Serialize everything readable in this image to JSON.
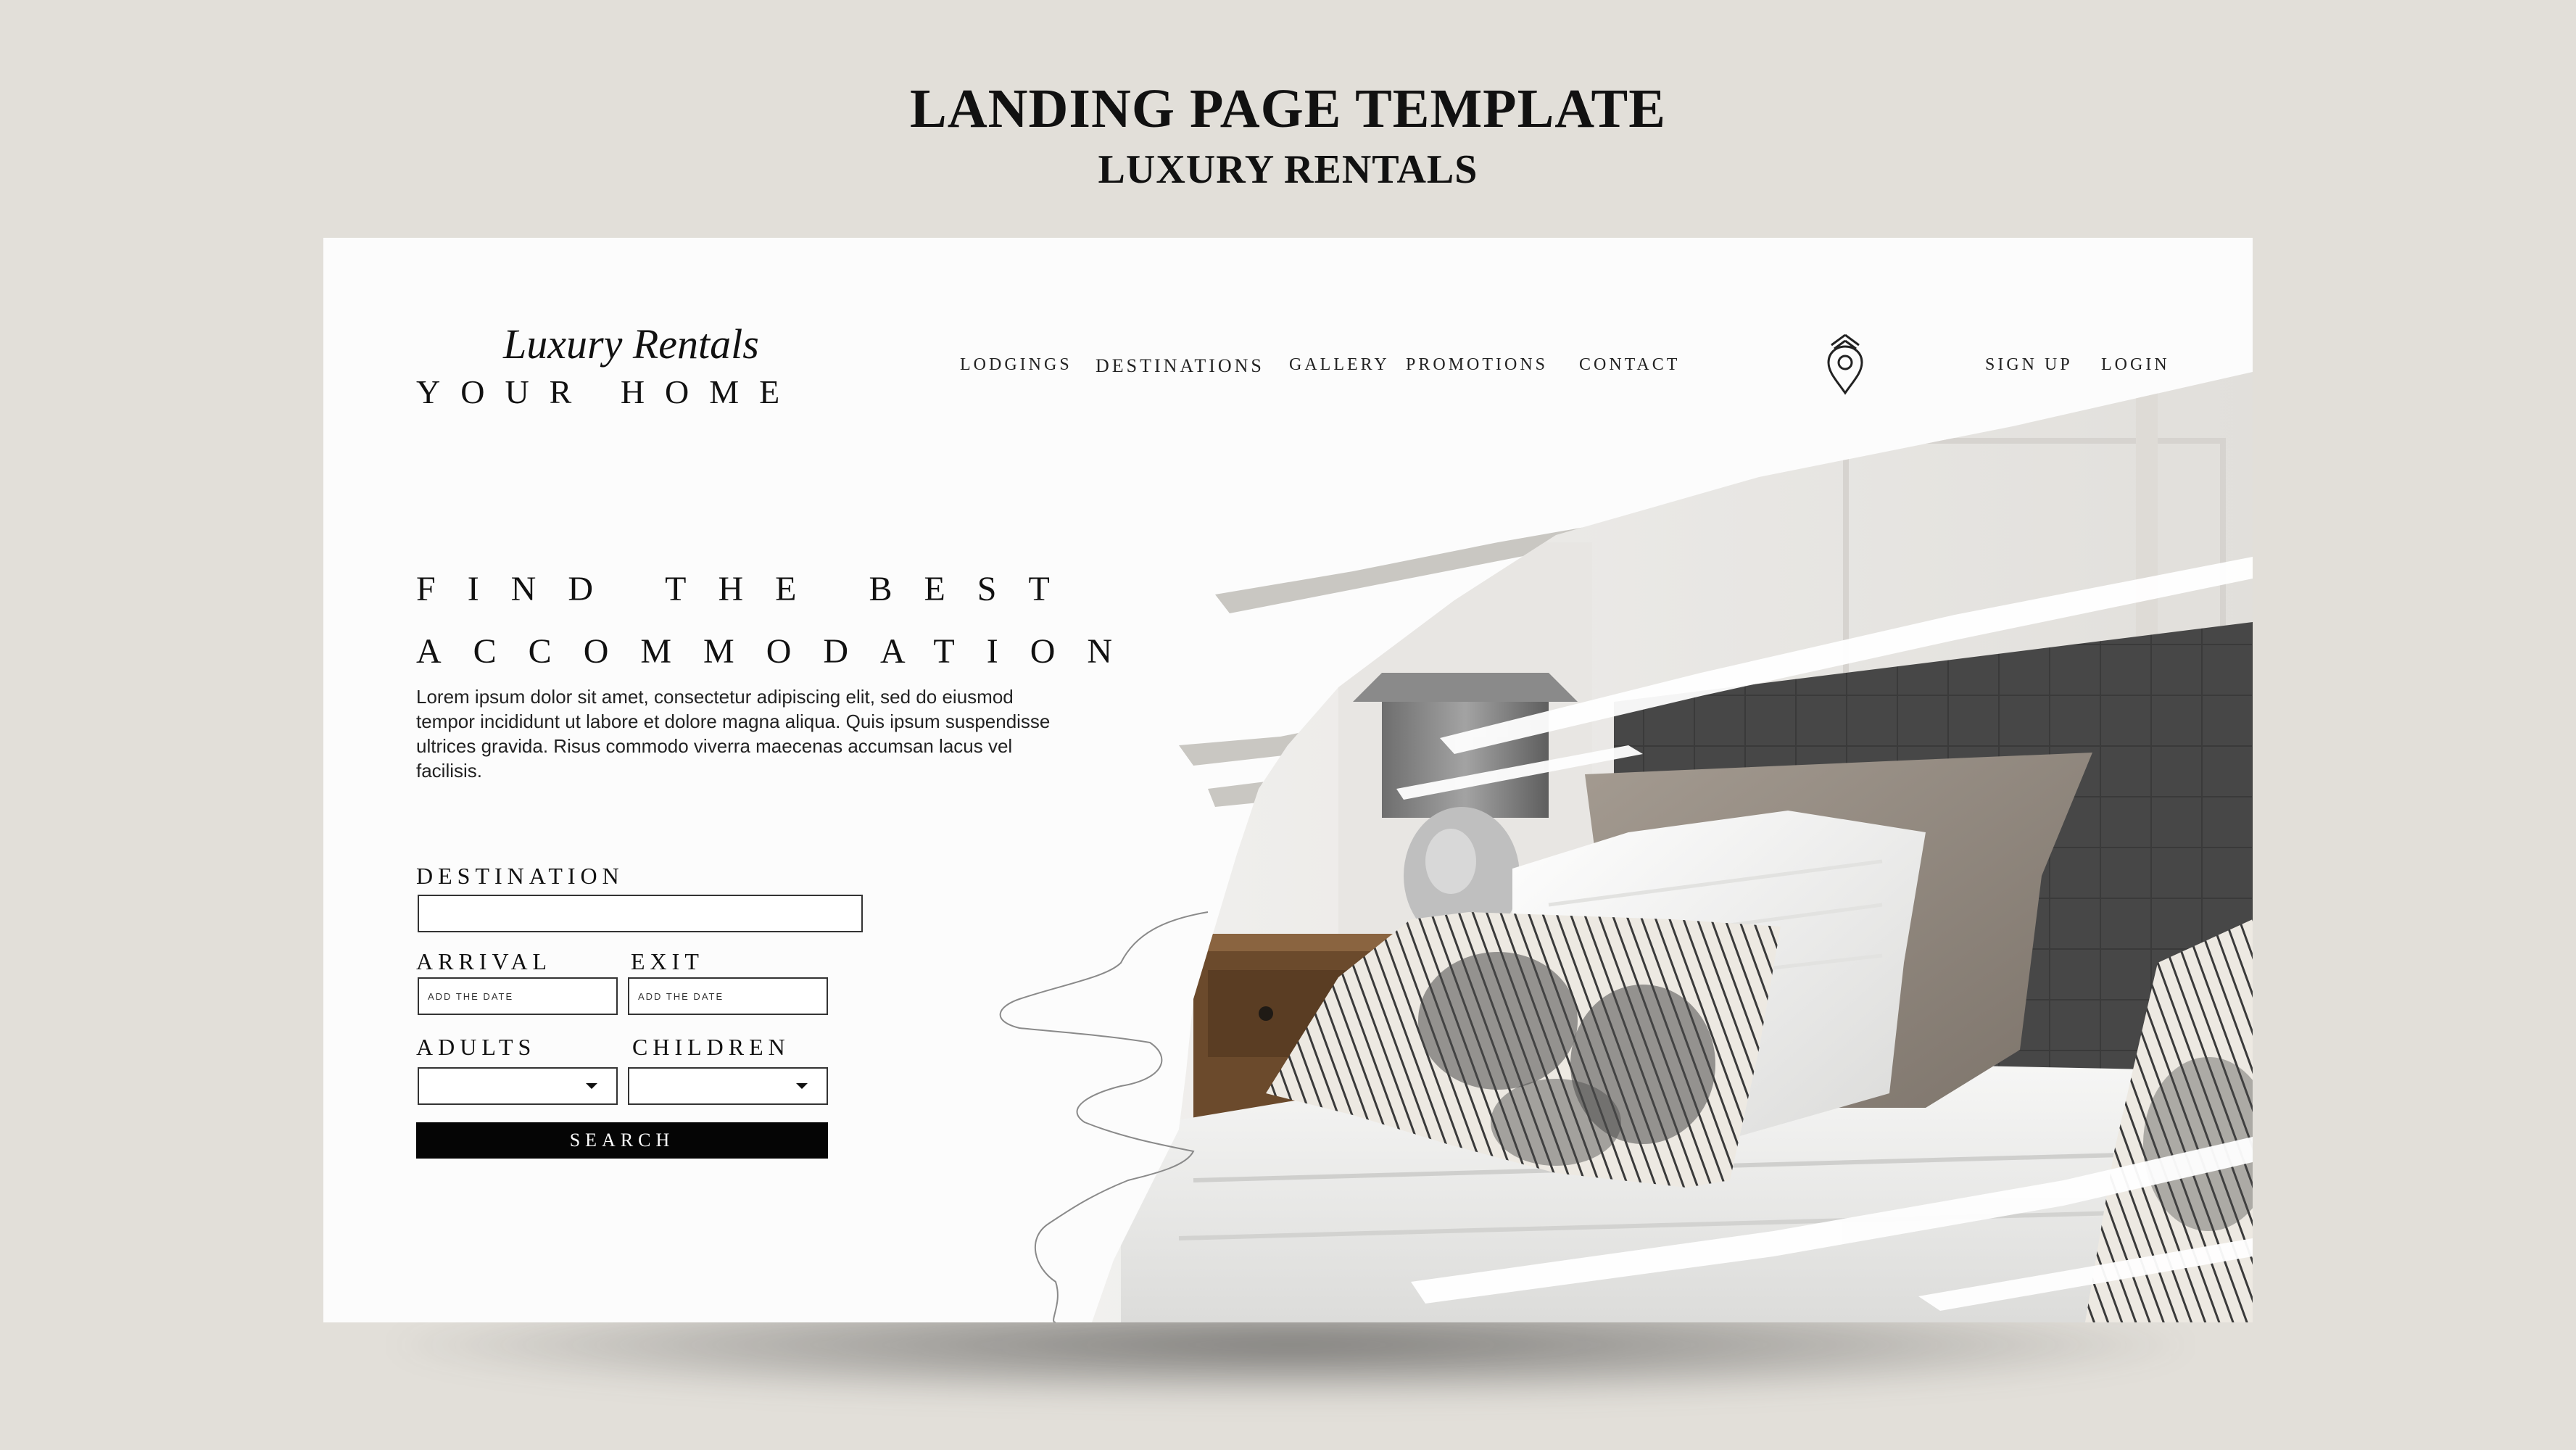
{
  "page": {
    "title": "LANDING PAGE TEMPLATE",
    "subtitle": "LUXURY RENTALS"
  },
  "header": {
    "logo_script": "Luxury Rentals",
    "logo_main": "YOUR HOME",
    "nav": [
      {
        "label": "LODGINGS"
      },
      {
        "label": "DESTINATIONS"
      },
      {
        "label": "GALLERY"
      },
      {
        "label": "PROMOTIONS"
      },
      {
        "label": "CONTACT"
      }
    ],
    "location_icon": "location-pin-icon",
    "sign_up": "SIGN UP",
    "login": "LOGIN"
  },
  "hero": {
    "heading_line1": "FIND THE BEST",
    "heading_line2": "ACCOMMODATION",
    "body": "Lorem ipsum dolor sit amet, consectetur adipiscing elit, sed do eiusmod tempor incididunt ut labore et dolore magna aliqua. Quis ipsum suspendisse ultrices gravida. Risus commodo viverra maecenas accumsan lacus vel facilisis.",
    "image": "bedroom-photo"
  },
  "search_form": {
    "destination_label": "DESTINATION",
    "destination_value": "",
    "arrival_label": "ARRIVAL",
    "arrival_placeholder": "ADD THE DATE",
    "exit_label": "EXIT",
    "exit_placeholder": "ADD THE DATE",
    "adults_label": "ADULTS",
    "adults_value": "",
    "children_label": "CHILDREN",
    "children_value": "",
    "search_label": "SEARCH"
  },
  "colors": {
    "background": "#e2dfd9",
    "card": "#fcfcfc",
    "text": "#111111",
    "button": "#050505",
    "headboard": "#4a4a4a",
    "brush": "#c9c7c2"
  }
}
